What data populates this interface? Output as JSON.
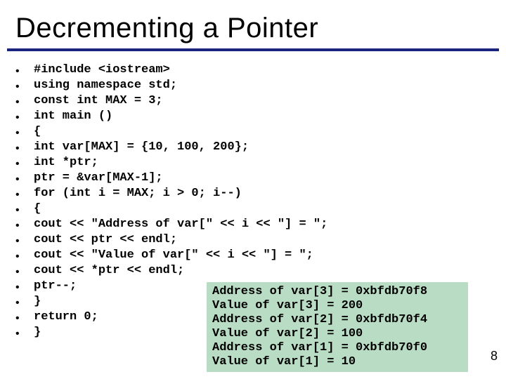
{
  "title": "Decrementing a Pointer",
  "code_lines": [
    "#include <iostream>",
    "using namespace std;",
    "const int MAX = 3;",
    "int main ()",
    "{",
    "int var[MAX] = {10, 100, 200};",
    "int *ptr;",
    "ptr = &var[MAX-1];",
    "for (int i = MAX; i > 0; i--)",
    "{",
    "cout << \"Address of var[\" << i << \"] = \";",
    "cout << ptr << endl;",
    "cout << \"Value of var[\" << i << \"] = \";",
    "cout << *ptr << endl;",
    "ptr--;",
    "}",
    "return 0;",
    "}"
  ],
  "output_lines": [
    "Address of var[3] = 0xbfdb70f8",
    "Value of var[3] = 200",
    "Address of var[2] = 0xbfdb70f4",
    "Value of var[2] = 100",
    "Address of var[1] = 0xbfdb70f0",
    "Value of var[1] = 10"
  ],
  "page_number": "8"
}
